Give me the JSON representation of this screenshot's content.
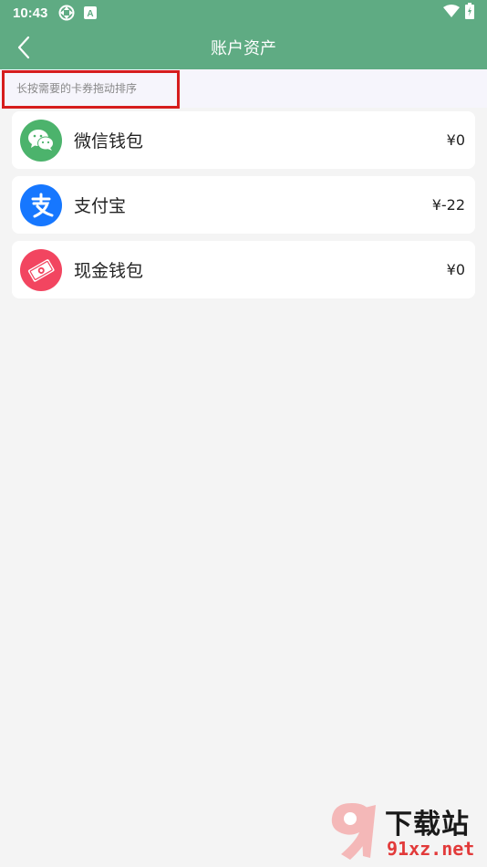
{
  "status_bar": {
    "time": "10:43",
    "icons": [
      "sync-icon",
      "keyboard-a-icon",
      "wifi-icon",
      "battery-icon"
    ],
    "keyboard_letter": "A"
  },
  "app_bar": {
    "title": "账户资产",
    "back_icon": "chevron-left-icon"
  },
  "hint": {
    "text": "长按需要的卡券拖动排序"
  },
  "accounts": [
    {
      "name": "微信钱包",
      "amount": "¥0",
      "icon": "wechat-icon",
      "color": "#4cb36c"
    },
    {
      "name": "支付宝",
      "amount": "¥-22",
      "icon": "alipay-icon",
      "color": "#1677ff"
    },
    {
      "name": "现金钱包",
      "amount": "¥0",
      "icon": "cash-icon",
      "color": "#f24560"
    }
  ],
  "colors": {
    "primary": "#5fab83",
    "background": "#f4f4f4",
    "highlight_border": "#d61d1d"
  },
  "watermark": {
    "text": "下载站",
    "url": "91xz.net"
  }
}
